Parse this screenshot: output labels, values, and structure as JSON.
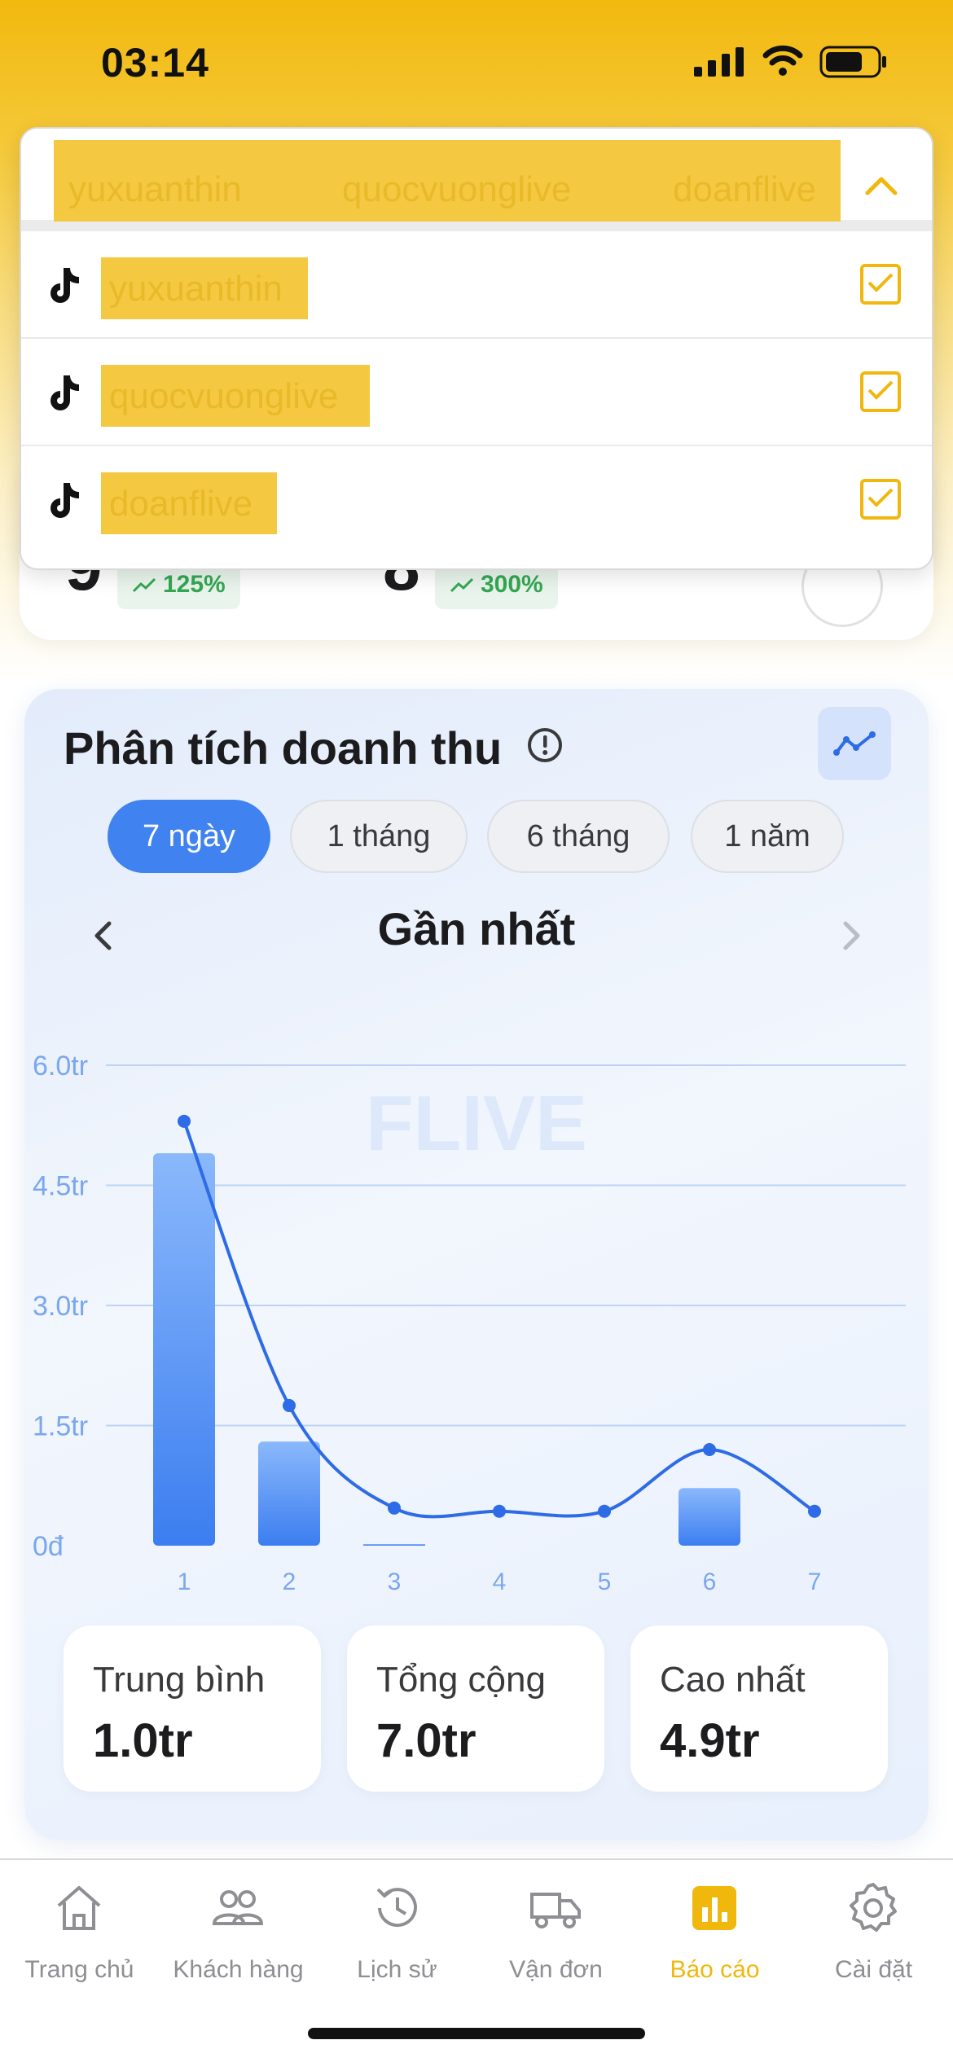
{
  "status_bar": {
    "time": "03:14"
  },
  "account_selector": {
    "chips": [
      "yuxuanthin",
      "quocvuonglive",
      "doanflive"
    ],
    "items": [
      {
        "label": "yuxuanthin",
        "checked": true
      },
      {
        "label": "quocvuonglive",
        "checked": true
      },
      {
        "label": "doanflive",
        "checked": true
      }
    ]
  },
  "stats": [
    {
      "value": "9",
      "change": "125%"
    },
    {
      "value": "8",
      "change": "300%"
    }
  ],
  "revenue": {
    "title": "Phân tích doanh thu",
    "tabs": [
      "7 ngày",
      "1 tháng",
      "6 tháng",
      "1 năm"
    ],
    "active_tab": 0,
    "period_label": "Gần nhất",
    "watermark": "FLIVE",
    "summary": [
      {
        "label": "Trung bình",
        "value": "1.0tr"
      },
      {
        "label": "Tổng cộng",
        "value": "7.0tr"
      },
      {
        "label": "Cao nhất",
        "value": "4.9tr"
      }
    ]
  },
  "chart_data": {
    "type": "bar",
    "categories": [
      "1",
      "2",
      "3",
      "4",
      "5",
      "6",
      "7"
    ],
    "values": [
      4.9,
      1.3,
      0.02,
      0,
      0,
      0.72,
      0
    ],
    "line_values": [
      5.3,
      1.75,
      0.47,
      0.43,
      0.43,
      1.2,
      0.43
    ],
    "y_ticks": [
      "0đ",
      "1.5tr",
      "3.0tr",
      "4.5tr",
      "6.0tr"
    ],
    "ylim": [
      0,
      6.0
    ],
    "grid": true,
    "colors": {
      "bar_top": "#8ab8fb",
      "bar_bottom": "#3c7ef0",
      "line": "#2e6be6",
      "grid": "#bcd3f5",
      "tick": "#7aa7ee"
    }
  },
  "bottom_nav": {
    "items": [
      {
        "label": "Trang chủ",
        "icon": "home-icon"
      },
      {
        "label": "Khách hàng",
        "icon": "customers-icon"
      },
      {
        "label": "Lịch sử",
        "icon": "history-icon"
      },
      {
        "label": "Vận đơn",
        "icon": "truck-icon"
      },
      {
        "label": "Báo cáo",
        "icon": "report-icon"
      },
      {
        "label": "Cài đặt",
        "icon": "settings-icon"
      }
    ],
    "active": 4,
    "active_color": "#f0b70c"
  }
}
